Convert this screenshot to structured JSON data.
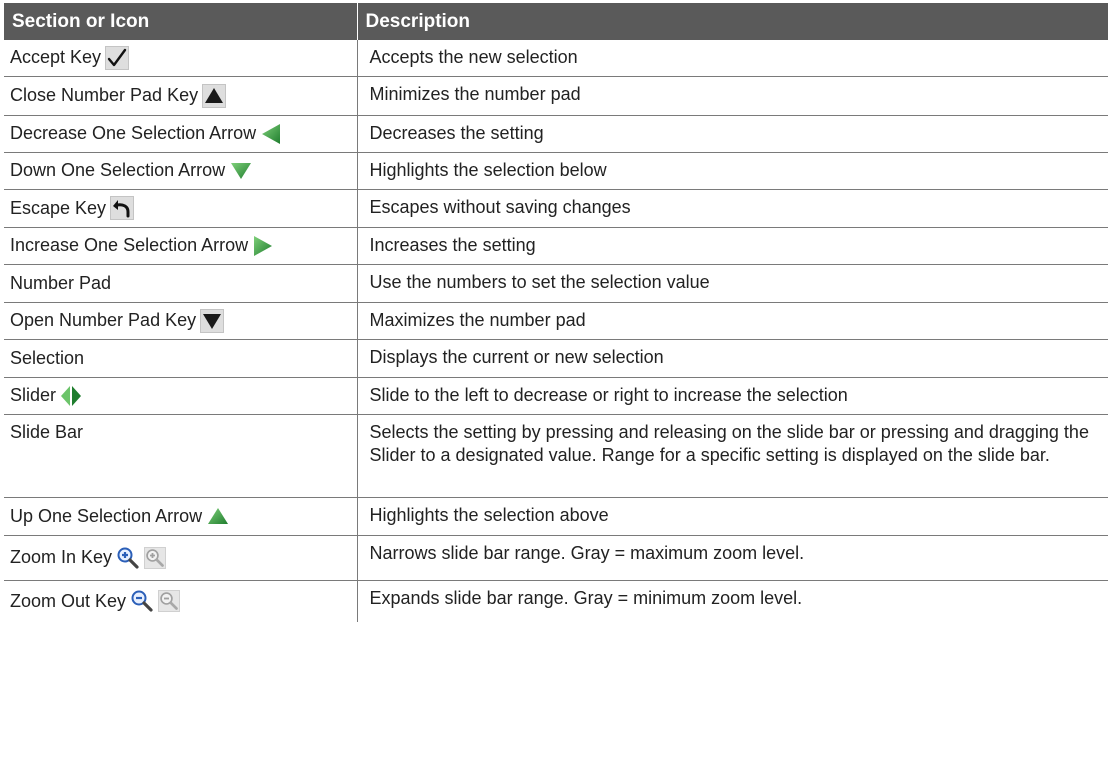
{
  "table": {
    "headers": [
      "Section or Icon",
      "Description"
    ],
    "rows": [
      {
        "name": "Accept Key",
        "icon": "checkmark-icon",
        "description": "Accepts the new selection"
      },
      {
        "name": "Close Number Pad Key",
        "icon": "triangle-up-black-icon",
        "description": "Minimizes the number pad"
      },
      {
        "name": "Decrease One Selection Arrow",
        "icon": "arrow-left-green-icon",
        "description": "Decreases the setting"
      },
      {
        "name": "Down One Selection Arrow",
        "icon": "arrow-down-green-icon",
        "description": "Highlights the selection below"
      },
      {
        "name": "Escape Key",
        "icon": "escape-return-arrow-icon",
        "description": "Escapes without saving changes"
      },
      {
        "name": "Increase One Selection Arrow",
        "icon": "arrow-right-green-icon",
        "description": "Increases the setting"
      },
      {
        "name": "Number Pad",
        "icon": "",
        "description": "Use the numbers to set the selection value"
      },
      {
        "name": "Open Number Pad Key",
        "icon": "triangle-down-black-icon",
        "description": "Maximizes the number pad"
      },
      {
        "name": "Selection",
        "icon": "",
        "description": "Displays the current or new selection"
      },
      {
        "name": "Slider",
        "icon": "slider-diamond-green-icon",
        "description": "Slide to the left to decrease or right to increase the selection"
      },
      {
        "name": "Slide Bar",
        "icon": "",
        "description": "Selects the setting by pressing and releasing on the slide bar or pressing and dragging the Slider to a designated value.  Range for a specific setting is displayed on the slide bar."
      },
      {
        "name": "Up One Selection Arrow",
        "icon": "arrow-up-green-icon",
        "description": "Highlights the selection above"
      },
      {
        "name": "Zoom In Key",
        "icon": "zoom-in-magnifier-icon",
        "description": "Narrows slide bar range.  Gray = maximum zoom level."
      },
      {
        "name": "Zoom Out Key",
        "icon": "zoom-out-magnifier-icon",
        "description": "Expands slide bar range.  Gray = minimum zoom level."
      }
    ]
  },
  "colors": {
    "header_bg": "#5a5a5a",
    "header_text": "#ffffff",
    "row_border": "#7a7a7a",
    "arrow_green": "#2e9a3c",
    "zoom_blue": "#3a6fc4"
  }
}
